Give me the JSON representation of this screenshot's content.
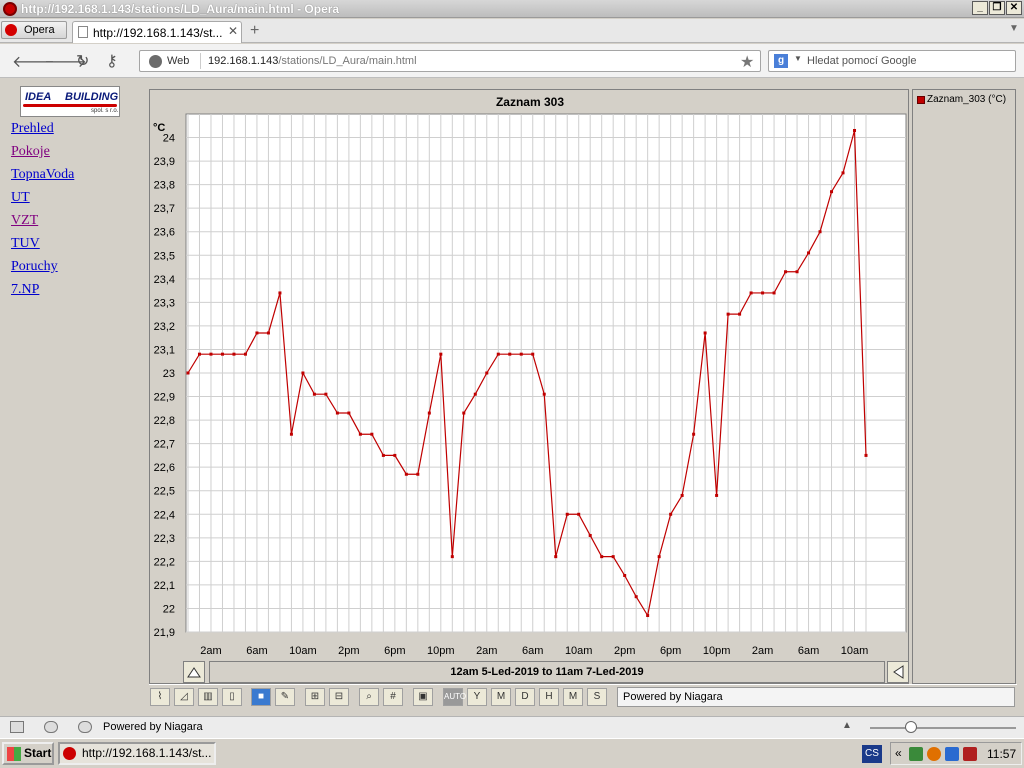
{
  "window": {
    "title": "http://192.168.1.143/stations/LD_Aura/main.html - Opera"
  },
  "tabs": {
    "menu_label": "Opera",
    "active_tab_label": "http://192.168.1.143/st..."
  },
  "navbar": {
    "web_label": "Web",
    "url_host": "192.168.1.143",
    "url_path": "/stations/LD_Aura/main.html",
    "search_placeholder": "Hledat pomocí Google"
  },
  "sidebar": {
    "logo_text_1": "IDEA",
    "logo_text_2": "BUILDING",
    "logo_sub": "spol. s r.o.",
    "items": [
      {
        "label": "Prehled",
        "visited": false
      },
      {
        "label": "Pokoje",
        "visited": true
      },
      {
        "label": "TopnaVoda",
        "visited": false
      },
      {
        "label": "UT",
        "visited": false
      },
      {
        "label": "VZT",
        "visited": true
      },
      {
        "label": "TUV",
        "visited": false
      },
      {
        "label": "Poruchy",
        "visited": false
      },
      {
        "label": "7.NP",
        "visited": false
      }
    ]
  },
  "chart_data": {
    "type": "line",
    "title": "Zaznam  303",
    "ylabel": "°C",
    "ylim": [
      21.9,
      24.1
    ],
    "yticks": [
      "21,9",
      "22",
      "22,1",
      "22,2",
      "22,3",
      "22,4",
      "22,5",
      "22,6",
      "22,7",
      "22,8",
      "22,9",
      "23",
      "23,1",
      "23,2",
      "23,3",
      "23,4",
      "23,5",
      "23,6",
      "23,7",
      "23,8",
      "23,9",
      "24"
    ],
    "xticks": [
      "2am",
      "6am",
      "10am",
      "2pm",
      "6pm",
      "10pm",
      "2am",
      "6am",
      "10am",
      "2pm",
      "6pm",
      "10pm",
      "2am",
      "6am",
      "10am"
    ],
    "xlim_hours": [
      0,
      59
    ],
    "series": [
      {
        "name": "Zaznam_303 (°C)",
        "color": "#c00000",
        "x_hours": [
          0,
          1,
          2,
          3,
          4,
          5,
          6,
          7,
          8,
          9,
          10,
          11,
          12,
          13,
          14,
          15,
          16,
          17,
          18,
          19,
          20,
          21,
          22,
          23,
          24,
          25,
          26,
          27,
          28,
          29,
          30,
          31,
          32,
          33,
          34,
          35,
          36,
          37,
          38,
          39,
          40,
          41,
          42,
          43,
          44,
          45,
          46,
          47,
          48,
          49,
          50,
          51,
          52,
          53,
          54,
          55,
          56,
          57,
          58,
          59
        ],
        "values": [
          23.0,
          23.08,
          23.08,
          23.08,
          23.08,
          23.08,
          23.17,
          23.17,
          23.34,
          22.74,
          23.0,
          22.91,
          22.91,
          22.83,
          22.83,
          22.74,
          22.74,
          22.65,
          22.65,
          22.57,
          22.57,
          22.83,
          23.08,
          22.22,
          22.83,
          22.91,
          23.0,
          23.08,
          23.08,
          23.08,
          23.08,
          22.91,
          22.22,
          22.4,
          22.4,
          22.31,
          22.22,
          22.22,
          22.14,
          22.05,
          21.97,
          22.22,
          22.4,
          22.48,
          22.74,
          23.17,
          22.48,
          23.25,
          23.25,
          23.34,
          23.34,
          23.34,
          23.43,
          23.43,
          23.51,
          23.6,
          23.77,
          23.85,
          24.03,
          22.65
        ]
      }
    ],
    "range_label": "12am 5-Led-2019 to 11am 7-Led-2019",
    "legend": "right"
  },
  "toolbar": {
    "buttons": [
      "AUTO",
      "Y",
      "M",
      "D",
      "H",
      "M",
      "S"
    ],
    "powered_by": "Powered by Niagara"
  },
  "statusbar": {
    "text": "Powered by Niagara"
  },
  "taskbar": {
    "start_label": "Start",
    "item_label": "http://192.168.1.143/st...",
    "lang": "CS",
    "clock": "11:57"
  }
}
